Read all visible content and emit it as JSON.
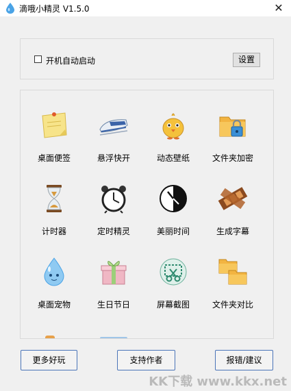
{
  "window": {
    "title": "滴哦小精灵 V1.5.0",
    "close_glyph": "✕"
  },
  "startup": {
    "autostart_label": "开机自动启动",
    "autostart_checked": false,
    "settings_label": "设置"
  },
  "tools": [
    {
      "label": "桌面便签",
      "icon": "sticky-note-icon"
    },
    {
      "label": "悬浮快开",
      "icon": "train-icon"
    },
    {
      "label": "动态壁纸",
      "icon": "chick-icon"
    },
    {
      "label": "文件夹加密",
      "icon": "folder-lock-icon"
    },
    {
      "label": "计时器",
      "icon": "hourglass-icon"
    },
    {
      "label": "定时精灵",
      "icon": "alarm-clock-icon"
    },
    {
      "label": "美丽时间",
      "icon": "clock-face-icon"
    },
    {
      "label": "生成字幕",
      "icon": "film-strip-icon"
    },
    {
      "label": "桌面宠物",
      "icon": "water-drop-pet-icon"
    },
    {
      "label": "生日节日",
      "icon": "gift-box-icon"
    },
    {
      "label": "屏幕截图",
      "icon": "scissors-screenshot-icon"
    },
    {
      "label": "文件夹对比",
      "icon": "folders-compare-icon"
    }
  ],
  "footer": {
    "more_label": "更多好玩",
    "support_label": "支持作者",
    "feedback_label": "报错/建议"
  },
  "watermark": "KK下载 www.kkx.net",
  "colors": {
    "background": "#f0f0f0",
    "button_border": "#4a74b8",
    "drop_blue": "#4aa3e6"
  }
}
